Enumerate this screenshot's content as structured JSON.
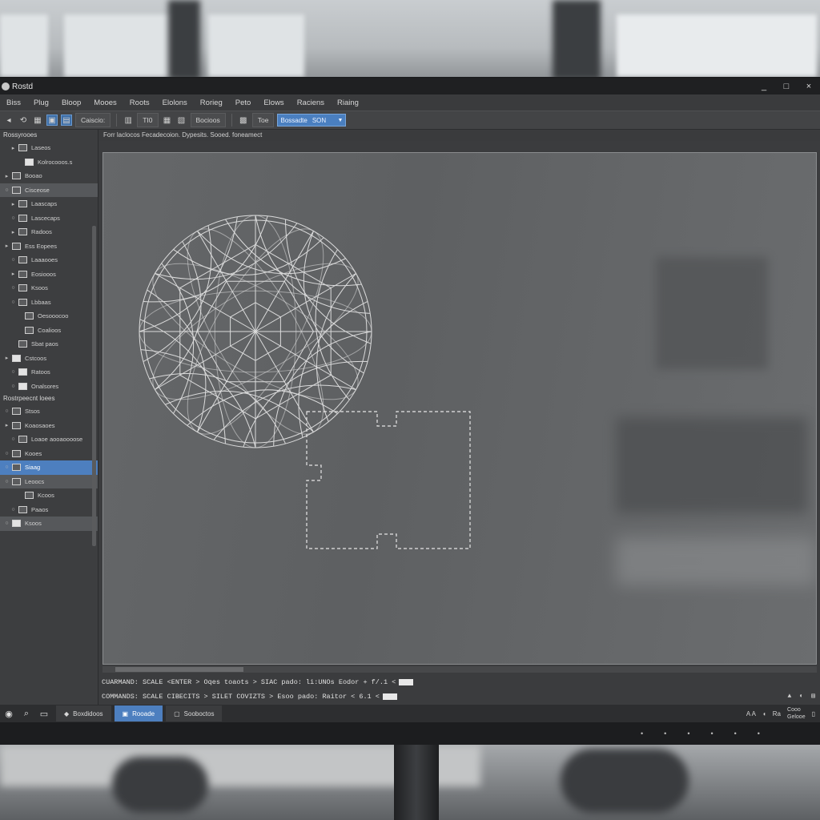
{
  "window": {
    "title": "Rostd",
    "controls": [
      "_",
      "□",
      "×"
    ]
  },
  "menu": [
    "Biss",
    "Plug",
    "Bloop",
    "Mooes",
    "Roots",
    "Elolons",
    "Rorieg",
    "Peto",
    "Elows",
    "Raciens",
    "Riaing"
  ],
  "toolbar": {
    "btn_1": "Caiscio:",
    "btn_2": "Bocioos",
    "btn_3": "Toe",
    "btn_4": "TI0",
    "select_left": "Bossadte",
    "select_right": "SON"
  },
  "viewport": {
    "breadcrumb": "Forr laclocos  Fecadecoion.  Dypesits.  Sooed.  foneamect"
  },
  "left_panel": {
    "header": "Rossyrooes",
    "section_2": "Rostrpeecnt loees",
    "rows": [
      {
        "label": "Laseos"
      },
      {
        "label": "Kolrocooos.s"
      },
      {
        "label": "Booao"
      },
      {
        "label": "Cisceose"
      },
      {
        "label": "Laascaps"
      },
      {
        "label": "Lascecaps"
      },
      {
        "label": "Radoos"
      },
      {
        "label": "Ess Eopees"
      },
      {
        "label": "Laaaooes"
      },
      {
        "label": "Eosiooos"
      },
      {
        "label": "Ksoos"
      },
      {
        "label": "Lbbaas"
      },
      {
        "label": "Oesooocoo"
      },
      {
        "label": "Coalioos"
      },
      {
        "label": "Sbat paos"
      },
      {
        "label": "Cstcoos"
      },
      {
        "label": "Ratoos"
      },
      {
        "label": "Onalsores"
      },
      {
        "label": "Stsos"
      },
      {
        "label": "Koaosaoes"
      },
      {
        "label": "Loaoe aooaoooose"
      },
      {
        "label": "Kooes"
      },
      {
        "label": "Siaag"
      },
      {
        "label": "Leoocs"
      },
      {
        "label": "Kcoos"
      },
      {
        "label": "Paaos"
      },
      {
        "label": "Ksoos"
      }
    ]
  },
  "command": {
    "line_1": "CUARMAND: SCALE <ENTER > Oqes toaots > SIAC pado:  li:UNOs  Eodor  +  f/.1  <",
    "line_2": "COMMANDS: SCALE CIBECITS > SILET COVIZTS > Esoo pado:   Raitor  <  6.1  <"
  },
  "taskbar": {
    "task_1": "Boxdidoos",
    "task_2": "Rooade",
    "task_3": "Sooboctos",
    "tray_1": "A A",
    "tray_2": "Ra",
    "clock_1": "Cooo",
    "clock_2": "Gelooe"
  },
  "accent_color": "#4d7fbf"
}
